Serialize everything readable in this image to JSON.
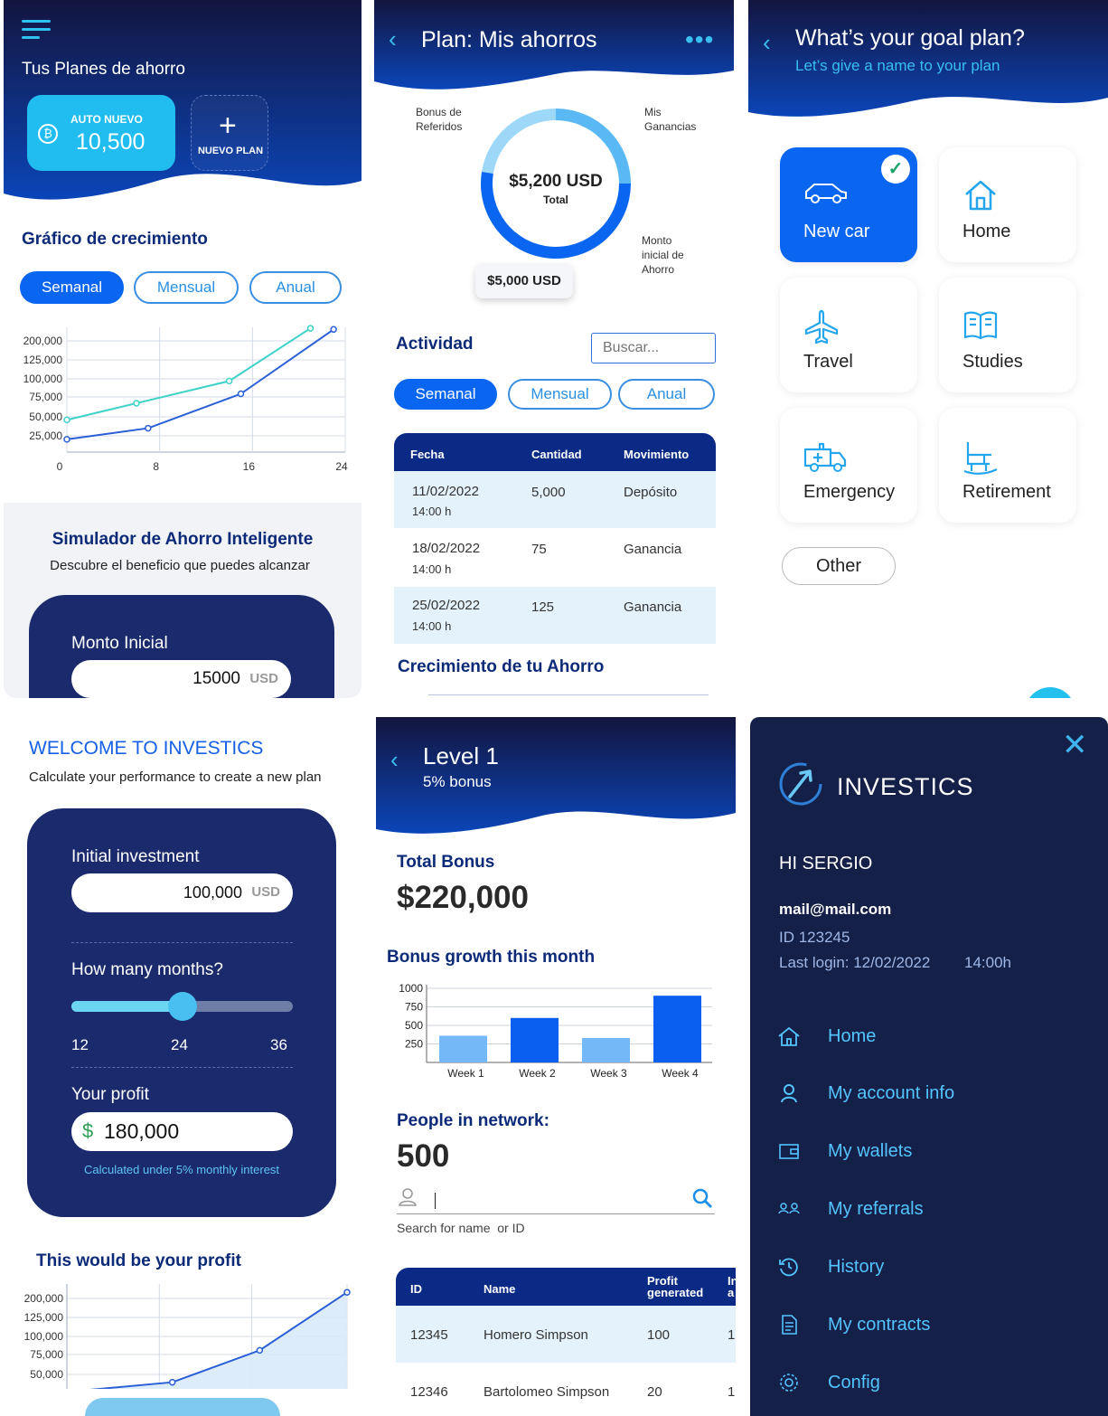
{
  "panel1": {
    "title": "Tus Planes de ahorro",
    "plan_card": {
      "label": "AUTO NUEVO",
      "value": "10,500"
    },
    "new_plan_label": "NUEVO PLAN",
    "growth_title": "Gráfico de crecimiento",
    "tabs": [
      "Semanal",
      "Mensual",
      "Anual"
    ],
    "simulator": {
      "title": "Simulador de Ahorro Inteligente",
      "subtitle": "Descubre el beneficio que puedes alcanzar",
      "field_label": "Monto Inicial",
      "field_value": "15000",
      "field_unit": "USD"
    }
  },
  "panel2": {
    "title": "Plan: Mis ahorros",
    "donut": {
      "center_value": "$5,200 USD",
      "center_label": "Total",
      "labels": [
        "Bonus de Referidos",
        "Mis Ganancias",
        "Monto inicial de Ahorro"
      ],
      "tooltip": "$5,000 USD"
    },
    "activity_title": "Actividad",
    "search_placeholder": "Buscar...",
    "tabs": [
      "Semanal",
      "Mensual",
      "Anual"
    ],
    "table": {
      "headers": [
        "Fecha",
        "Cantidad",
        "Movimiento"
      ],
      "rows": [
        {
          "date": "11/02/2022",
          "time": "14:00 h",
          "amount": "5,000",
          "type": "Depósito"
        },
        {
          "date": "18/02/2022",
          "time": "14:00 h",
          "amount": "75",
          "type": "Ganancia"
        },
        {
          "date": "25/02/2022",
          "time": "14:00 h",
          "amount": "125",
          "type": "Ganancia"
        }
      ]
    },
    "growth_title": "Crecimiento de tu Ahorro"
  },
  "panel3": {
    "title": "What’s your goal plan?",
    "subtitle": "Let’s give a name to your plan",
    "goals": [
      "New car",
      "Home",
      "Travel",
      "Studies",
      "Emergency",
      "Retirement"
    ],
    "other_label": "Other"
  },
  "panel4": {
    "title": "WELCOME TO INVESTICS",
    "subtitle": "Calculate your performance to create a new plan",
    "initial_label": "Initial investment",
    "initial_value": "100,000",
    "initial_unit": "USD",
    "months_label": "How many months?",
    "months_ticks": [
      "12",
      "24",
      "36"
    ],
    "months_selected_fraction": 0.5,
    "profit_label": "Your profit",
    "profit_currency": "$",
    "profit_value": "180,000",
    "note": "Calculated under 5% monthly interest",
    "chart_title": "This would be your profit"
  },
  "panel5": {
    "title": "Level 1",
    "subtitle": "5% bonus",
    "total_bonus_label": "Total Bonus",
    "total_bonus_value": "$220,000",
    "bonus_growth_title": "Bonus growth this month",
    "people_label": "People in network:",
    "people_value": "500",
    "search_hint": "Search for name  or ID",
    "table": {
      "headers": [
        "ID",
        "Name",
        "Profit generated",
        "In a"
      ],
      "rows": [
        {
          "id": "12345",
          "name": "Homero Simpson",
          "profit": "100",
          "extra": "1,"
        },
        {
          "id": "12346",
          "name": "Bartolomeo Simpson",
          "profit": "20",
          "extra": "1,"
        }
      ]
    }
  },
  "panel6": {
    "brand": "INVESTICS",
    "greeting": "HI SERGIO",
    "email": "mail@mail.com",
    "id_text": "ID 123245",
    "last_login": "Last login: 12/02/2022",
    "last_login_time": "14:00h",
    "menu": [
      "Home",
      "My account info",
      "My wallets",
      "My referrals",
      "History",
      "My contracts",
      "Config"
    ]
  },
  "colors": {
    "navy": "#1a2a6c",
    "accent": "#0a66f0",
    "cyan": "#23c0ee",
    "light_blue": "#6cc7f5"
  },
  "chart_data": [
    {
      "type": "line",
      "x": [
        0,
        8,
        16,
        24
      ],
      "xticks": [
        "0",
        "8",
        "16",
        "24"
      ],
      "yticks": [
        "25,000",
        "50,000",
        "75,000",
        "100,000",
        "125,000",
        "200,000"
      ],
      "series": [
        {
          "values_y": [
            45000,
            75000,
            115000,
            210000
          ],
          "x": [
            0,
            6,
            14,
            21
          ]
        },
        {
          "values_y": [
            10000,
            30000,
            92000,
            208000
          ],
          "x": [
            0,
            7,
            15,
            23
          ]
        }
      ]
    },
    {
      "type": "pie",
      "labels": [
        "Bonus de Referidos",
        "Mis Ganancias",
        "Monto inicial de Ahorro"
      ],
      "values": [
        75,
        125,
        5000
      ]
    },
    {
      "type": "bar",
      "categories": [
        "Week 1",
        "Week 2",
        "Week 3",
        "Week 4"
      ],
      "values": [
        360,
        600,
        330,
        900
      ],
      "yticks": [
        "250",
        "500",
        "750",
        "1000"
      ],
      "ylim": [
        0,
        1000
      ]
    },
    {
      "type": "area",
      "yticks": [
        "50,000",
        "75,000",
        "100,000",
        "125,000",
        "200,000"
      ],
      "x": [
        0,
        1,
        2,
        3
      ],
      "values": [
        30000,
        55000,
        110000,
        210000
      ]
    }
  ]
}
